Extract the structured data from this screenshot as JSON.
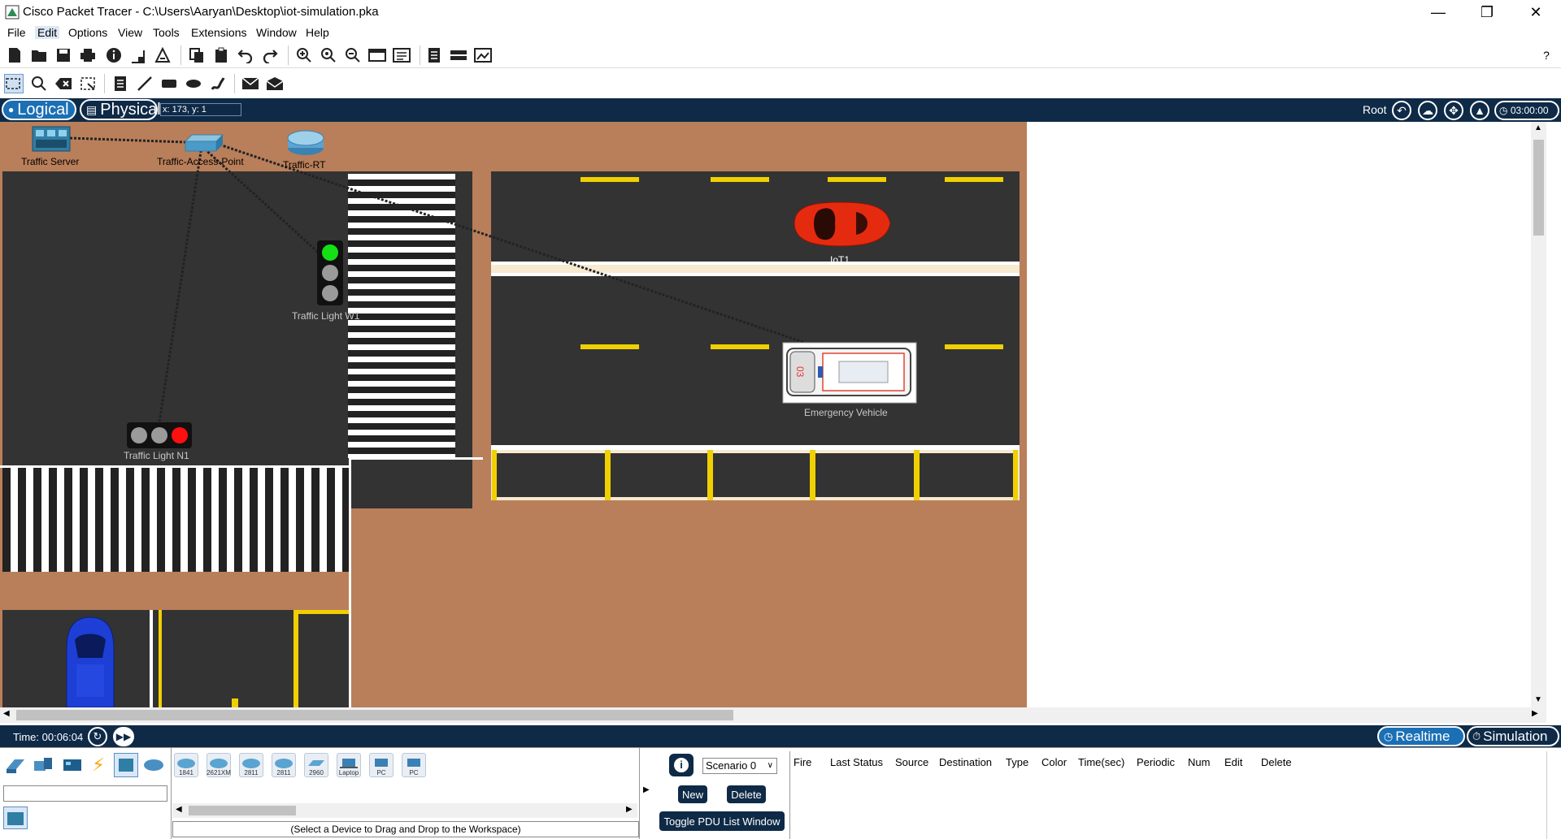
{
  "window": {
    "title": "Cisco Packet Tracer - C:\\Users\\Aaryan\\Desktop\\iot-simulation.pka",
    "minimize": "—",
    "restore": "❐",
    "close": "✕"
  },
  "menu": [
    "File",
    "Edit",
    "Options",
    "View",
    "Tools",
    "Extensions",
    "Window",
    "Help"
  ],
  "toolbar": {
    "help": "?"
  },
  "tabs": {
    "logical": "Logical",
    "physical": "Physical",
    "coords": "x: 173, y: 1",
    "root": "Root",
    "clock": "03:00:00"
  },
  "devices": {
    "traffic_server": "Traffic Server",
    "traffic_access_point": "Traffic-Access-Point",
    "traffic_rt": "Traffic-RT",
    "traffic_light_w1": "Traffic Light W1",
    "traffic_light_n1": "Traffic Light N1",
    "iot1": "IoT1",
    "emergency_vehicle": "Emergency Vehicle"
  },
  "status": {
    "time": "Time: 00:06:04",
    "realtime": "Realtime",
    "simulation": "Simulation"
  },
  "palette": {
    "models": [
      "1841",
      "2621XM",
      "2811",
      "2811",
      "2960",
      "Laptop",
      "PC",
      "PC"
    ],
    "hint": "(Select a Device to Drag and Drop to the Workspace)"
  },
  "scenario": {
    "selected": "Scenario 0",
    "new": "New",
    "delete": "Delete",
    "toggle": "Toggle PDU List Window",
    "info": "i"
  },
  "pdu_columns": [
    "Fire",
    "Last Status",
    "Source",
    "Destination",
    "Type",
    "Color",
    "Time(sec)",
    "Periodic",
    "Num",
    "Edit",
    "Delete"
  ],
  "colors": {
    "ground": "#b97f5a",
    "road": "#333333",
    "navy": "#0e2a47",
    "lane_yellow": "#f0d000"
  }
}
